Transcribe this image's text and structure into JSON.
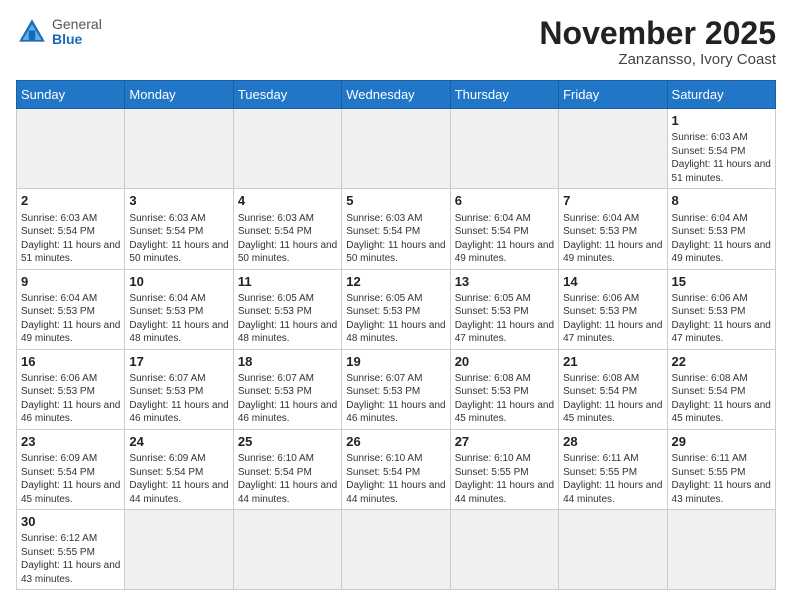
{
  "header": {
    "logo_general": "General",
    "logo_blue": "Blue",
    "month_title": "November 2025",
    "location": "Zanzansso, Ivory Coast"
  },
  "weekdays": [
    "Sunday",
    "Monday",
    "Tuesday",
    "Wednesday",
    "Thursday",
    "Friday",
    "Saturday"
  ],
  "weeks": [
    [
      {
        "day": "",
        "info": ""
      },
      {
        "day": "",
        "info": ""
      },
      {
        "day": "",
        "info": ""
      },
      {
        "day": "",
        "info": ""
      },
      {
        "day": "",
        "info": ""
      },
      {
        "day": "",
        "info": ""
      },
      {
        "day": "1",
        "info": "Sunrise: 6:03 AM\nSunset: 5:54 PM\nDaylight: 11 hours\nand 51 minutes."
      }
    ],
    [
      {
        "day": "2",
        "info": "Sunrise: 6:03 AM\nSunset: 5:54 PM\nDaylight: 11 hours\nand 51 minutes."
      },
      {
        "day": "3",
        "info": "Sunrise: 6:03 AM\nSunset: 5:54 PM\nDaylight: 11 hours\nand 50 minutes."
      },
      {
        "day": "4",
        "info": "Sunrise: 6:03 AM\nSunset: 5:54 PM\nDaylight: 11 hours\nand 50 minutes."
      },
      {
        "day": "5",
        "info": "Sunrise: 6:03 AM\nSunset: 5:54 PM\nDaylight: 11 hours\nand 50 minutes."
      },
      {
        "day": "6",
        "info": "Sunrise: 6:04 AM\nSunset: 5:54 PM\nDaylight: 11 hours\nand 49 minutes."
      },
      {
        "day": "7",
        "info": "Sunrise: 6:04 AM\nSunset: 5:53 PM\nDaylight: 11 hours\nand 49 minutes."
      },
      {
        "day": "8",
        "info": "Sunrise: 6:04 AM\nSunset: 5:53 PM\nDaylight: 11 hours\nand 49 minutes."
      }
    ],
    [
      {
        "day": "9",
        "info": "Sunrise: 6:04 AM\nSunset: 5:53 PM\nDaylight: 11 hours\nand 49 minutes."
      },
      {
        "day": "10",
        "info": "Sunrise: 6:04 AM\nSunset: 5:53 PM\nDaylight: 11 hours\nand 48 minutes."
      },
      {
        "day": "11",
        "info": "Sunrise: 6:05 AM\nSunset: 5:53 PM\nDaylight: 11 hours\nand 48 minutes."
      },
      {
        "day": "12",
        "info": "Sunrise: 6:05 AM\nSunset: 5:53 PM\nDaylight: 11 hours\nand 48 minutes."
      },
      {
        "day": "13",
        "info": "Sunrise: 6:05 AM\nSunset: 5:53 PM\nDaylight: 11 hours\nand 47 minutes."
      },
      {
        "day": "14",
        "info": "Sunrise: 6:06 AM\nSunset: 5:53 PM\nDaylight: 11 hours\nand 47 minutes."
      },
      {
        "day": "15",
        "info": "Sunrise: 6:06 AM\nSunset: 5:53 PM\nDaylight: 11 hours\nand 47 minutes."
      }
    ],
    [
      {
        "day": "16",
        "info": "Sunrise: 6:06 AM\nSunset: 5:53 PM\nDaylight: 11 hours\nand 46 minutes."
      },
      {
        "day": "17",
        "info": "Sunrise: 6:07 AM\nSunset: 5:53 PM\nDaylight: 11 hours\nand 46 minutes."
      },
      {
        "day": "18",
        "info": "Sunrise: 6:07 AM\nSunset: 5:53 PM\nDaylight: 11 hours\nand 46 minutes."
      },
      {
        "day": "19",
        "info": "Sunrise: 6:07 AM\nSunset: 5:53 PM\nDaylight: 11 hours\nand 46 minutes."
      },
      {
        "day": "20",
        "info": "Sunrise: 6:08 AM\nSunset: 5:53 PM\nDaylight: 11 hours\nand 45 minutes."
      },
      {
        "day": "21",
        "info": "Sunrise: 6:08 AM\nSunset: 5:54 PM\nDaylight: 11 hours\nand 45 minutes."
      },
      {
        "day": "22",
        "info": "Sunrise: 6:08 AM\nSunset: 5:54 PM\nDaylight: 11 hours\nand 45 minutes."
      }
    ],
    [
      {
        "day": "23",
        "info": "Sunrise: 6:09 AM\nSunset: 5:54 PM\nDaylight: 11 hours\nand 45 minutes."
      },
      {
        "day": "24",
        "info": "Sunrise: 6:09 AM\nSunset: 5:54 PM\nDaylight: 11 hours\nand 44 minutes."
      },
      {
        "day": "25",
        "info": "Sunrise: 6:10 AM\nSunset: 5:54 PM\nDaylight: 11 hours\nand 44 minutes."
      },
      {
        "day": "26",
        "info": "Sunrise: 6:10 AM\nSunset: 5:54 PM\nDaylight: 11 hours\nand 44 minutes."
      },
      {
        "day": "27",
        "info": "Sunrise: 6:10 AM\nSunset: 5:55 PM\nDaylight: 11 hours\nand 44 minutes."
      },
      {
        "day": "28",
        "info": "Sunrise: 6:11 AM\nSunset: 5:55 PM\nDaylight: 11 hours\nand 44 minutes."
      },
      {
        "day": "29",
        "info": "Sunrise: 6:11 AM\nSunset: 5:55 PM\nDaylight: 11 hours\nand 43 minutes."
      }
    ],
    [
      {
        "day": "30",
        "info": "Sunrise: 6:12 AM\nSunset: 5:55 PM\nDaylight: 11 hours\nand 43 minutes."
      },
      {
        "day": "",
        "info": ""
      },
      {
        "day": "",
        "info": ""
      },
      {
        "day": "",
        "info": ""
      },
      {
        "day": "",
        "info": ""
      },
      {
        "day": "",
        "info": ""
      },
      {
        "day": "",
        "info": ""
      }
    ]
  ]
}
